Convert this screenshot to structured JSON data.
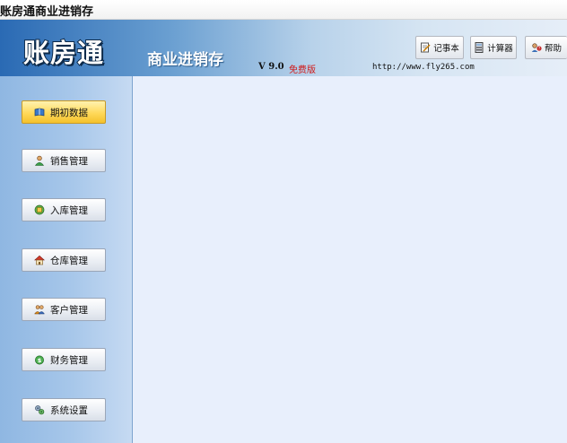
{
  "window": {
    "title": "账房通商业进销存"
  },
  "header": {
    "logo": "账房通",
    "subtitle": "商业进销存",
    "version": "V 9.0",
    "edition": "免费版",
    "url": "http://www.fly265.com"
  },
  "toolbar": [
    {
      "label": "记事本",
      "icon": "notepad-icon"
    },
    {
      "label": "计算器",
      "icon": "calculator-icon"
    },
    {
      "label": "帮助",
      "icon": "help-icon"
    }
  ],
  "sidebar": {
    "active_index": 0,
    "items": [
      {
        "label": "期初数据",
        "icon": "book-icon"
      },
      {
        "label": "销售管理",
        "icon": "person-icon"
      },
      {
        "label": "入库管理",
        "icon": "box-icon"
      },
      {
        "label": "仓库管理",
        "icon": "house-icon"
      },
      {
        "label": "客户管理",
        "icon": "users-icon"
      },
      {
        "label": "财务管理",
        "icon": "money-icon"
      },
      {
        "label": "系统设置",
        "icon": "settings-icon"
      }
    ]
  },
  "colors": {
    "accent": "#f4c12c",
    "edition_text": "#d01818",
    "content_bg": "#e8effc"
  }
}
